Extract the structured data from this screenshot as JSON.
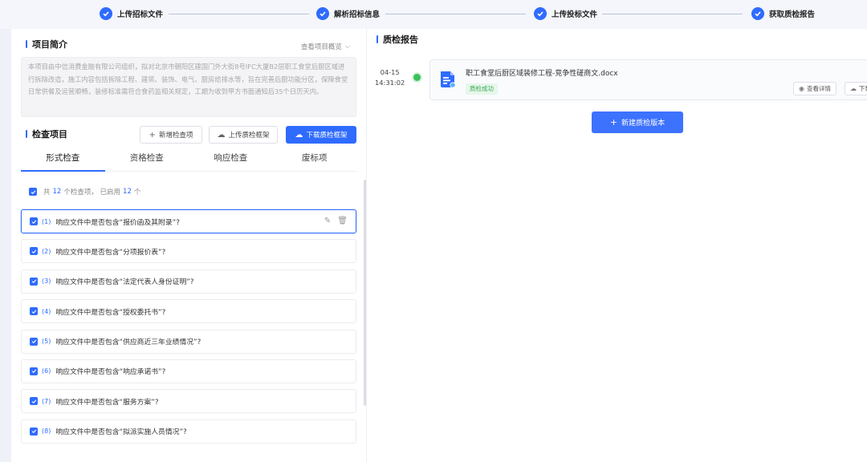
{
  "steps": [
    {
      "label": "上传招标文件"
    },
    {
      "label": "解析招标信息"
    },
    {
      "label": "上传投标文件"
    },
    {
      "label": "获取质检报告"
    }
  ],
  "intro": {
    "title": "项目简介",
    "overview_link": "查看项目概览",
    "text": "本项目由中信消费金融有限公司组织，拟对北京市朝阳区建国门外大街8号IFC大厦B2层职工食堂后厨区域进行拆除改造，施工内容包括拆除工程、建筑、装饰、电气、厨房给排水等，旨在完善后厨功能分区，保障食堂日常供餐及运营顺畅，装修标准需符合食药监相关规定，工期为收到甲方书面通知后35个日历天内。"
  },
  "check": {
    "title": "检查项目",
    "buttons": {
      "add": "新增检查项",
      "upload": "上传质检框架",
      "download": "下载质检框架"
    },
    "tabs": [
      "形式检查",
      "资格检查",
      "响应检查",
      "废标项"
    ],
    "active_tab": 0,
    "summary": {
      "prefix": "共",
      "total": "12",
      "middle": "个检查项，  已启用",
      "enabled": "12",
      "suffix": "个"
    },
    "items": [
      {
        "index": "(1)",
        "text": "响应文件中是否包含“报价函及其附录”?"
      },
      {
        "index": "(2)",
        "text": "响应文件中是否包含“分项报价表”?"
      },
      {
        "index": "(3)",
        "text": "响应文件中是否包含“法定代表人身份证明”?"
      },
      {
        "index": "(4)",
        "text": "响应文件中是否包含“授权委托书”?"
      },
      {
        "index": "(5)",
        "text": "响应文件中是否包含“供应商近三年业绩情况”?"
      },
      {
        "index": "(6)",
        "text": "响应文件中是否包含“响应承诺书”?"
      },
      {
        "index": "(7)",
        "text": "响应文件中是否包含“服务方案”?"
      },
      {
        "index": "(8)",
        "text": "响应文件中是否包含“拟派实施人员情况”?"
      }
    ],
    "selected_item": 0
  },
  "report": {
    "title": "质检报告",
    "entry": {
      "date": "04-15",
      "time": "14:31:02",
      "filename": "职工食堂后厨区域装修工程-竞争性磋商文.docx",
      "status": "质检成功",
      "view_label": "查看详情",
      "download_label": "下载"
    },
    "new_button": "新建质检版本"
  },
  "colors": {
    "accent": "#2f6bff",
    "success": "#3cc05a"
  }
}
